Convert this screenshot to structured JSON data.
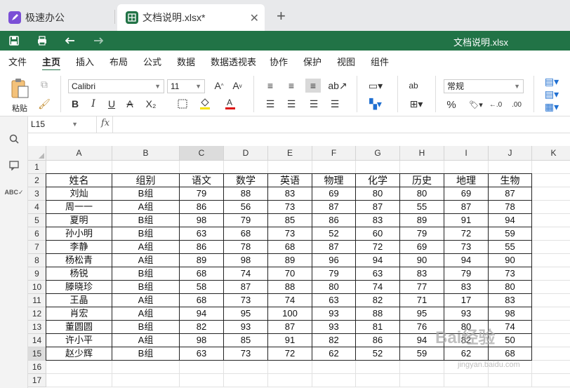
{
  "tabs": [
    {
      "label": "极速办公",
      "icon": "rocket-icon",
      "color": "#7b4fd6"
    },
    {
      "label": "文档说明.xlsx*",
      "icon": "spreadsheet-icon",
      "color": "#217346"
    }
  ],
  "document_title": "文档说明.xlsx",
  "menu": [
    "文件",
    "主页",
    "插入",
    "布局",
    "公式",
    "数据",
    "数据透视表",
    "协作",
    "保护",
    "视图",
    "组件"
  ],
  "active_menu": "主页",
  "ribbon": {
    "paste_label": "粘贴",
    "font_name": "Calibri",
    "font_size": "11",
    "number_format": "常规",
    "bold": "B",
    "italic": "I",
    "underline": "U",
    "strikethrough": "A",
    "subscript": "X₂"
  },
  "name_box": "L15",
  "fx_label": "fx",
  "columns": [
    "A",
    "B",
    "C",
    "D",
    "E",
    "F",
    "G",
    "H",
    "I",
    "J",
    "K"
  ],
  "selected_column": "C",
  "selected_row": "15",
  "rows": [
    "1",
    "2",
    "3",
    "4",
    "5",
    "6",
    "7",
    "8",
    "9",
    "10",
    "11",
    "12",
    "13",
    "14",
    "15",
    "16",
    "17"
  ],
  "table": {
    "headers": [
      "姓名",
      "组别",
      "语文",
      "数学",
      "英语",
      "物理",
      "化学",
      "历史",
      "地理",
      "生物"
    ],
    "data": [
      [
        "刘灿",
        "B组",
        "79",
        "88",
        "83",
        "69",
        "80",
        "80",
        "69",
        "87"
      ],
      [
        "周一一",
        "A组",
        "86",
        "56",
        "73",
        "87",
        "87",
        "55",
        "87",
        "78"
      ],
      [
        "夏明",
        "B组",
        "98",
        "79",
        "85",
        "86",
        "83",
        "89",
        "91",
        "94"
      ],
      [
        "孙小明",
        "B组",
        "63",
        "68",
        "73",
        "52",
        "60",
        "79",
        "72",
        "59"
      ],
      [
        "李静",
        "A组",
        "86",
        "78",
        "68",
        "87",
        "72",
        "69",
        "73",
        "55"
      ],
      [
        "杨松青",
        "A组",
        "89",
        "98",
        "89",
        "96",
        "94",
        "90",
        "94",
        "90"
      ],
      [
        "杨锐",
        "B组",
        "68",
        "74",
        "70",
        "79",
        "63",
        "83",
        "79",
        "73"
      ],
      [
        "滕晓珍",
        "B组",
        "58",
        "87",
        "88",
        "80",
        "74",
        "77",
        "83",
        "80"
      ],
      [
        "王晶",
        "A组",
        "68",
        "73",
        "74",
        "63",
        "82",
        "71",
        "17",
        "83"
      ],
      [
        "肖宏",
        "A组",
        "94",
        "95",
        "100",
        "93",
        "88",
        "95",
        "93",
        "98"
      ],
      [
        "董圆圆",
        "B组",
        "82",
        "93",
        "87",
        "93",
        "81",
        "76",
        "80",
        "74"
      ],
      [
        "许小平",
        "A组",
        "98",
        "85",
        "91",
        "82",
        "86",
        "94",
        "82",
        "50"
      ],
      [
        "赵少辉",
        "B组",
        "63",
        "73",
        "72",
        "62",
        "52",
        "59",
        "62",
        "68"
      ]
    ]
  },
  "watermark": {
    "text": "Bai经验",
    "sub": "jingyan.baidu.com"
  }
}
